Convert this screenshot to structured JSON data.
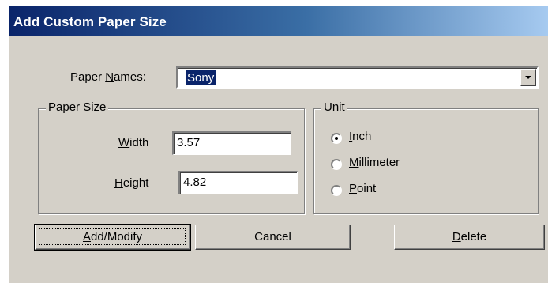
{
  "window": {
    "title": "Add Custom Paper Size"
  },
  "paper_names": {
    "label_pre": "Paper ",
    "label_key": "N",
    "label_post": "ames:",
    "value": "Sony"
  },
  "paper_size": {
    "group_title": "Paper Size",
    "width_label_key": "W",
    "width_label_rest": "idth",
    "width_value": "3.57",
    "height_label_key": "H",
    "height_label_rest": "eight",
    "height_value": "4.82"
  },
  "unit": {
    "group_title": "Unit",
    "selected": "Inch",
    "options": [
      {
        "key": "I",
        "rest": "nch"
      },
      {
        "key": "M",
        "rest": "illimeter"
      },
      {
        "key": "P",
        "rest": "oint"
      }
    ]
  },
  "buttons": {
    "add_modify_key": "A",
    "add_modify_rest": "dd/Modify",
    "cancel": "Cancel",
    "delete_key": "D",
    "delete_rest": "elete"
  }
}
